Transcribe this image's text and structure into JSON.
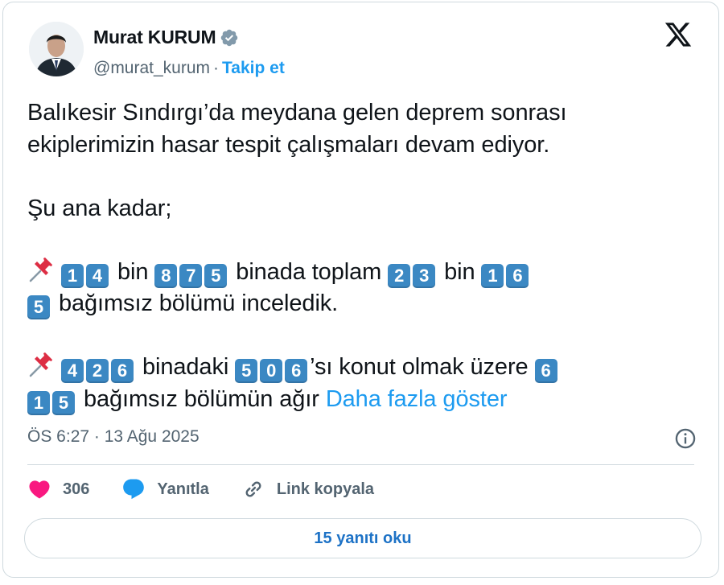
{
  "author": {
    "name": "Murat KURUM",
    "handle": "@murat_kurum",
    "separator": "·",
    "follow_label": "Takip et"
  },
  "tweet": {
    "line1": "Balıkesir Sındırgı’da meydana gelen deprem sonrası",
    "line2": "ekiplerimizin hasar tespit çalışmaları devam ediyor.",
    "line3": "Şu ana kadar;",
    "p1": {
      "a": [
        "1",
        "4"
      ],
      "t1": " bin ",
      "b": [
        "8",
        "7",
        "5"
      ],
      "t2": " binada toplam ",
      "c": [
        "2",
        "3"
      ],
      "t3": " bin ",
      "d": [
        "1",
        "6"
      ],
      "e": [
        "5"
      ],
      "t4": " bağımsız bölümü inceledik."
    },
    "p2": {
      "a": [
        "4",
        "2",
        "6"
      ],
      "t1": " binadaki ",
      "b": [
        "5",
        "0",
        "6"
      ],
      "t2": "’sı konut olmak üzere ",
      "c": [
        "6"
      ],
      "d": [
        "1",
        "5"
      ],
      "t3": " bağımsız bölümün ağır "
    },
    "show_more": "Daha fazla göster"
  },
  "timestamp": "ÖS 6:27 · 13 Ağu 2025",
  "actions": {
    "likes": "306",
    "reply_label": "Yanıtla",
    "copy_link_label": "Link kopyala"
  },
  "read_replies_label": "15 yanıtı oku",
  "colors": {
    "accent": "#1d9bf0",
    "keycap": "#3b88c3",
    "heart": "#f91880"
  }
}
